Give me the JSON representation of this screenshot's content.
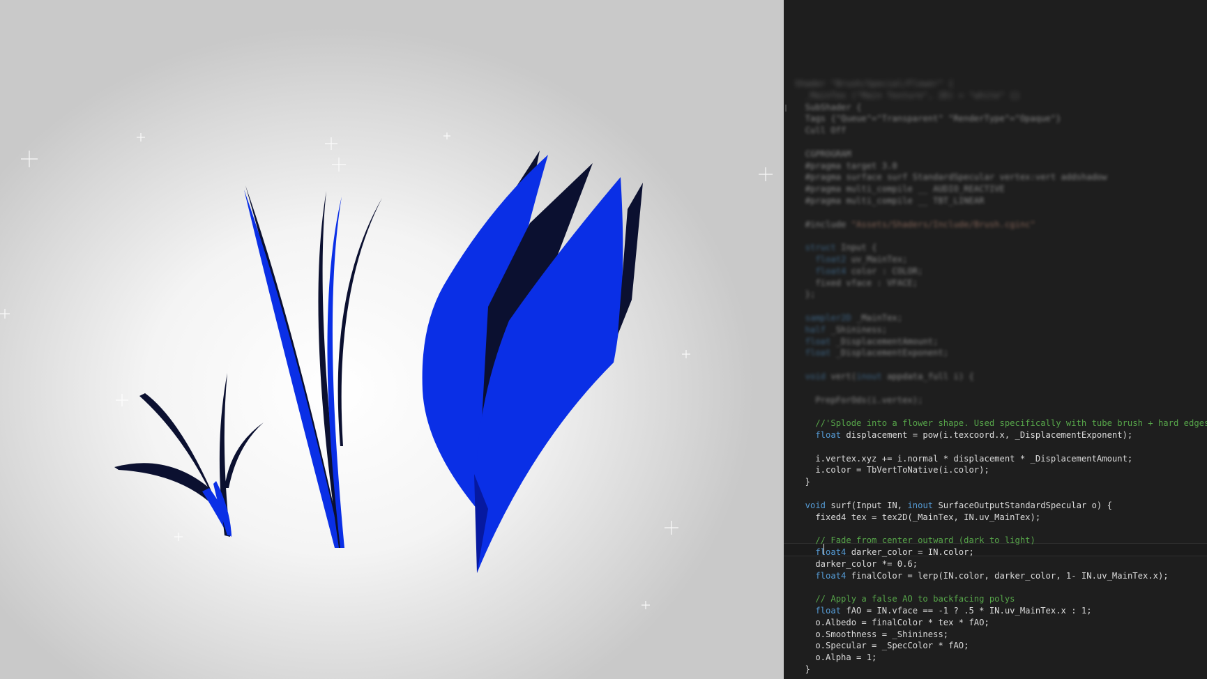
{
  "scene": {
    "colors": {
      "petal_blue": "#0a2fe6",
      "petal_dark": "#0b1030",
      "background": "#ffffff"
    }
  },
  "editor": {
    "lines": [
      {
        "kind": "blur-strong",
        "segments": [
          {
            "c": "txt",
            "t": "Shader \"Brush/Special/Flower\" {"
          }
        ]
      },
      {
        "kind": "blur-strong",
        "segments": [
          {
            "c": "txt",
            "t": "  _MainTex (\"Main Texture\", 2D) = \"white\" {}"
          }
        ]
      },
      {
        "kind": "blur",
        "segments": [
          {
            "c": "txt",
            "t": "  SubShader {"
          }
        ]
      },
      {
        "kind": "blur",
        "segments": [
          {
            "c": "txt",
            "t": "  Tags {\"Queue\"=\"Transparent\" \"RenderType\"=\"Opaque\"}"
          }
        ]
      },
      {
        "kind": "blur",
        "segments": [
          {
            "c": "txt",
            "t": "  Cull Off"
          }
        ]
      },
      {
        "kind": "blur",
        "segments": [
          {
            "c": "txt",
            "t": ""
          }
        ]
      },
      {
        "kind": "blur",
        "segments": [
          {
            "c": "txt",
            "t": "  CGPROGRAM"
          }
        ]
      },
      {
        "kind": "blur",
        "segments": [
          {
            "c": "txt",
            "t": "  #pragma target 3.0"
          }
        ]
      },
      {
        "kind": "blur",
        "segments": [
          {
            "c": "txt",
            "t": "  #pragma surface surf StandardSpecular vertex:vert addshadow"
          }
        ]
      },
      {
        "kind": "blur",
        "segments": [
          {
            "c": "txt",
            "t": "  #pragma multi_compile __ AUDIO_REACTIVE"
          }
        ]
      },
      {
        "kind": "blur",
        "segments": [
          {
            "c": "txt",
            "t": "  #pragma multi_compile __ TBT_LINEAR"
          }
        ]
      },
      {
        "kind": "blur",
        "segments": [
          {
            "c": "txt",
            "t": ""
          }
        ]
      },
      {
        "kind": "blur",
        "segments": [
          {
            "c": "txt",
            "t": "  #include "
          },
          {
            "c": "str",
            "t": "\"Assets/Shaders/Include/Brush.cginc\""
          }
        ]
      },
      {
        "kind": "blur",
        "segments": [
          {
            "c": "txt",
            "t": ""
          }
        ]
      },
      {
        "kind": "blur",
        "segments": [
          {
            "c": "kw",
            "t": "  struct "
          },
          {
            "c": "txt",
            "t": "Input {"
          }
        ]
      },
      {
        "kind": "blur",
        "segments": [
          {
            "c": "kw",
            "t": "    float2 "
          },
          {
            "c": "txt",
            "t": "uv_MainTex;"
          }
        ]
      },
      {
        "kind": "blur",
        "segments": [
          {
            "c": "kw",
            "t": "    float4 "
          },
          {
            "c": "txt",
            "t": "color : COLOR;"
          }
        ]
      },
      {
        "kind": "blur",
        "segments": [
          {
            "c": "txt",
            "t": "    fixed vface : VFACE;"
          }
        ]
      },
      {
        "kind": "blur",
        "segments": [
          {
            "c": "txt",
            "t": "  };"
          }
        ]
      },
      {
        "kind": "blur",
        "segments": [
          {
            "c": "txt",
            "t": ""
          }
        ]
      },
      {
        "kind": "blur",
        "segments": [
          {
            "c": "kw",
            "t": "  sampler2D "
          },
          {
            "c": "txt",
            "t": "_MainTex;"
          }
        ]
      },
      {
        "kind": "blur",
        "segments": [
          {
            "c": "kw",
            "t": "  half "
          },
          {
            "c": "txt",
            "t": "_Shininess;"
          }
        ]
      },
      {
        "kind": "blur",
        "segments": [
          {
            "c": "kw",
            "t": "  float "
          },
          {
            "c": "txt",
            "t": "_DisplacementAmount;"
          }
        ]
      },
      {
        "kind": "blur",
        "segments": [
          {
            "c": "kw",
            "t": "  float "
          },
          {
            "c": "txt",
            "t": "_DisplacementExponent;"
          }
        ]
      },
      {
        "kind": "blur",
        "segments": [
          {
            "c": "txt",
            "t": ""
          }
        ]
      },
      {
        "kind": "blur",
        "segments": [
          {
            "c": "kw",
            "t": "  void "
          },
          {
            "c": "txt",
            "t": "vert("
          },
          {
            "c": "kw",
            "t": "inout "
          },
          {
            "c": "txt",
            "t": "appdata_full i) {"
          }
        ]
      },
      {
        "kind": "blur",
        "segments": [
          {
            "c": "txt",
            "t": ""
          }
        ]
      },
      {
        "kind": "blur",
        "segments": [
          {
            "c": "txt",
            "t": "    PrepForOds(i.vertex);"
          }
        ]
      },
      {
        "kind": "sharp",
        "segments": [
          {
            "c": "txt",
            "t": ""
          }
        ]
      },
      {
        "kind": "sharp",
        "segments": [
          {
            "c": "cm",
            "t": "    //'Splode into a flower shape. Used specifically with tube brush + hard edges"
          }
        ]
      },
      {
        "kind": "sharp",
        "segments": [
          {
            "c": "kw",
            "t": "    float "
          },
          {
            "c": "txt",
            "t": "displacement = pow(i.texcoord.x, _DisplacementExponent);"
          }
        ]
      },
      {
        "kind": "sharp",
        "segments": [
          {
            "c": "txt",
            "t": ""
          }
        ]
      },
      {
        "kind": "sharp",
        "segments": [
          {
            "c": "txt",
            "t": "    i.vertex.xyz += i.normal * displacement * _DisplacementAmount;"
          }
        ]
      },
      {
        "kind": "sharp",
        "segments": [
          {
            "c": "txt",
            "t": "    i.color = TbVertToNative(i.color);"
          }
        ]
      },
      {
        "kind": "sharp",
        "segments": [
          {
            "c": "txt",
            "t": "  }"
          }
        ]
      },
      {
        "kind": "sharp",
        "segments": [
          {
            "c": "txt",
            "t": ""
          }
        ]
      },
      {
        "kind": "sharp",
        "segments": [
          {
            "c": "kw",
            "t": "  void "
          },
          {
            "c": "txt",
            "t": "surf(Input IN, "
          },
          {
            "c": "kw",
            "t": "inout "
          },
          {
            "c": "txt",
            "t": "SurfaceOutputStandardSpecular o) {"
          }
        ]
      },
      {
        "kind": "sharp",
        "segments": [
          {
            "c": "txt",
            "t": "    fixed4 tex = tex2D(_MainTex, IN.uv_MainTex);"
          }
        ]
      },
      {
        "kind": "sharp",
        "segments": [
          {
            "c": "txt",
            "t": ""
          }
        ]
      },
      {
        "kind": "sharp",
        "segments": [
          {
            "c": "cm",
            "t": "    // Fade from center outward (dark to light)"
          }
        ]
      },
      {
        "kind": "sharp",
        "segments": [
          {
            "c": "kw",
            "t": "    float4 "
          },
          {
            "c": "txt",
            "t": "darker_color = IN.color;"
          }
        ]
      },
      {
        "kind": "sharp",
        "segments": [
          {
            "c": "txt",
            "t": "    darker_color *= 0.6;"
          }
        ]
      },
      {
        "kind": "sharp",
        "segments": [
          {
            "c": "kw",
            "t": "    float4 "
          },
          {
            "c": "txt",
            "t": "finalColor = lerp(IN.color, darker_color, 1- IN.uv_MainTex.x);"
          }
        ]
      },
      {
        "kind": "sharp",
        "segments": [
          {
            "c": "txt",
            "t": ""
          }
        ]
      },
      {
        "kind": "sharp",
        "segments": [
          {
            "c": "cm",
            "t": "    // Apply a false AO to backfacing polys"
          }
        ]
      },
      {
        "kind": "sharp",
        "segments": [
          {
            "c": "kw",
            "t": "    float "
          },
          {
            "c": "txt",
            "t": "fAO = IN.vface == -1 ? .5 * IN.uv_MainTex.x : 1;"
          }
        ]
      },
      {
        "kind": "sharp",
        "segments": [
          {
            "c": "txt",
            "t": "    o.Albedo = finalColor * tex * fAO;"
          }
        ]
      },
      {
        "kind": "sharp",
        "segments": [
          {
            "c": "txt",
            "t": "    o.Smoothness = _Shininess;"
          }
        ]
      },
      {
        "kind": "sharp",
        "segments": [
          {
            "c": "txt",
            "t": "    o.Specular = _SpecColor * fAO;"
          }
        ]
      },
      {
        "kind": "sharp",
        "segments": [
          {
            "c": "txt",
            "t": "    o.Alpha = 1;"
          }
        ]
      },
      {
        "kind": "sharp",
        "segments": [
          {
            "c": "txt",
            "t": "  }"
          }
        ]
      }
    ]
  }
}
